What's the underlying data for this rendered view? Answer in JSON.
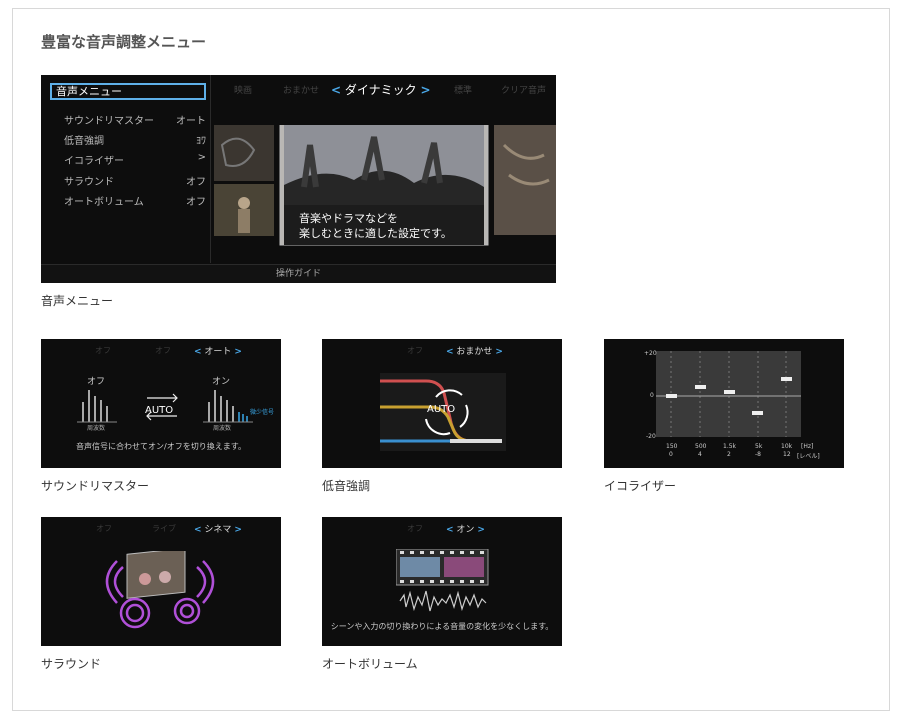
{
  "heading": "豊富な音声調整メニュー",
  "main_screen": {
    "menu_title": "音声メニュー",
    "menu_items": [
      {
        "label": "サウンドリマスター",
        "value": "オート"
      },
      {
        "label": "低音強調",
        "value": "ﾖﾜ"
      },
      {
        "label": "イコライザー",
        "value": ">"
      },
      {
        "label": "サラウンド",
        "value": "オフ"
      },
      {
        "label": "オートボリューム",
        "value": "オフ"
      }
    ],
    "modes": [
      "映画",
      "おまかせ",
      "標準",
      "クリア音声"
    ],
    "selected_mode": "ダイナミック",
    "description_line1": "音楽やドラマなどを",
    "description_line2": "楽しむときに適した設定です。",
    "guide": "操作ガイド",
    "caption": "音声メニュー"
  },
  "remaster": {
    "nav": [
      "オフ",
      "オフ"
    ],
    "selected": "オート",
    "off": "オフ",
    "on": "オン",
    "auto": "AUTO",
    "axis1": "周波数",
    "axis2": "周波数",
    "small_signal": "微少信号",
    "description": "音声信号に合わせてオン/オフを切り換えます。",
    "caption": "サウンドリマスター"
  },
  "bass": {
    "nav": "オフ",
    "selected": "おまかせ",
    "auto": "AUTO",
    "caption": "低音強調"
  },
  "equalizer": {
    "y_labels": [
      "+20",
      "0",
      "-20"
    ],
    "bands": [
      "150",
      "500",
      "1.5k",
      "5k",
      "10k"
    ],
    "levels": [
      "0",
      "4",
      "2",
      "-8",
      "12"
    ],
    "hz": "[Hz]",
    "level_label": "[レベル]",
    "caption": "イコライザー"
  },
  "surround": {
    "nav": [
      "オフ",
      "ライブ"
    ],
    "selected": "シネマ",
    "caption": "サラウンド"
  },
  "autovolume": {
    "nav": "オフ",
    "selected": "オン",
    "description": "シーンや入力の切り換わりによる音量の変化を少なくします。",
    "caption": "オートボリューム"
  }
}
